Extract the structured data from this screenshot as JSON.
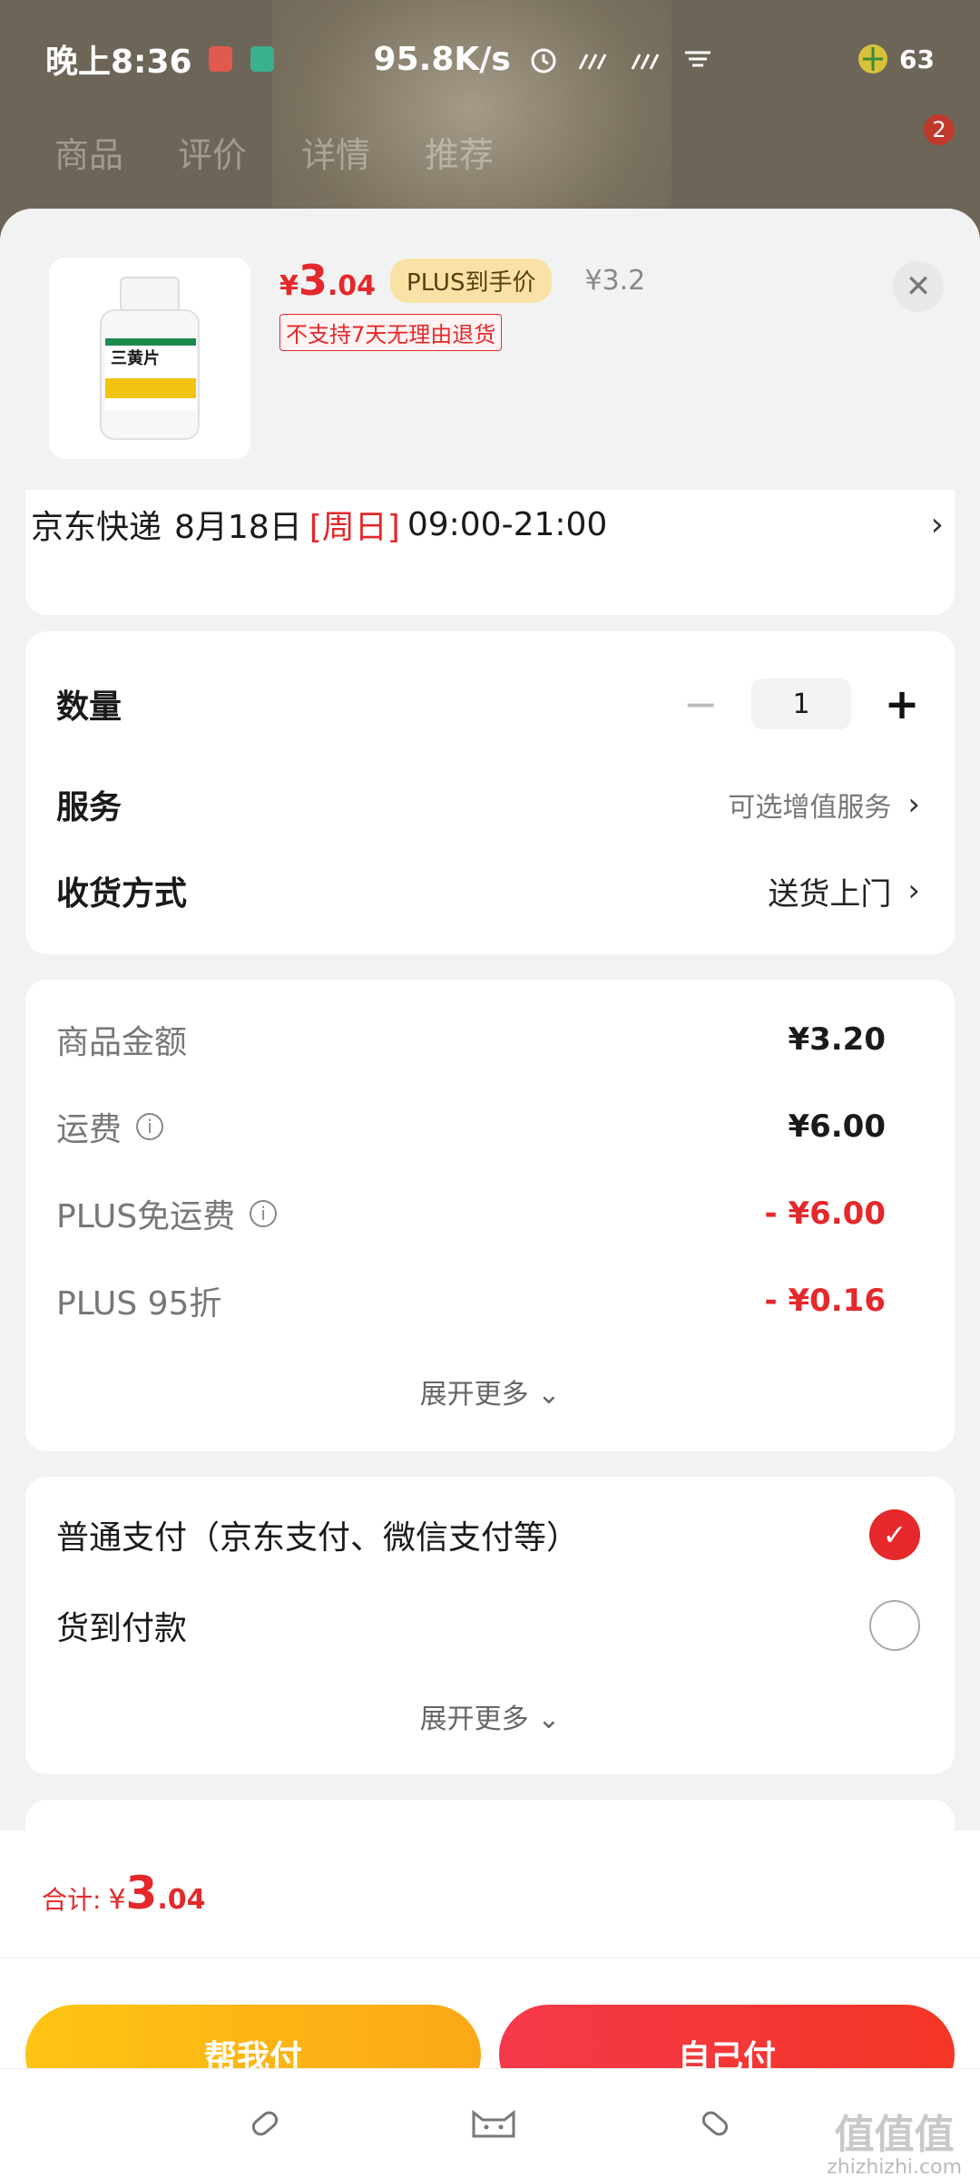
{
  "status_bar": {
    "time": "晚上8:36",
    "network_speed": "95.8K/s",
    "battery": "63"
  },
  "background": {
    "tabs": [
      "商品",
      "评价",
      "详情",
      "推荐"
    ],
    "cart_badge": "2"
  },
  "product": {
    "price_currency": "¥",
    "price_int": "3",
    "price_dec": ".04",
    "plus_tag": "PLUS到手价",
    "original_price": "¥3.2",
    "return_policy": "不支持7天无理由退货",
    "label_text": "三黄片",
    "close_label": "✕"
  },
  "delivery": {
    "carrier": "京东快递",
    "date": "8月18日",
    "weekday": "[周日]",
    "time_window": "09:00-21:00"
  },
  "quantity": {
    "label": "数量",
    "value": "1",
    "minus": "−",
    "plus": "+"
  },
  "service": {
    "label": "服务",
    "value": "可选增值服务"
  },
  "receive": {
    "label": "收货方式",
    "value": "送货上门"
  },
  "fees": {
    "items": [
      {
        "label": "商品金额",
        "value": "¥3.20",
        "info": false,
        "red": false
      },
      {
        "label": "运费",
        "value": "¥6.00",
        "info": true,
        "red": false
      },
      {
        "label": "PLUS免运费",
        "value": "- ¥6.00",
        "info": true,
        "red": true
      },
      {
        "label": "PLUS 95折",
        "value": "- ¥0.16",
        "info": false,
        "red": true
      }
    ],
    "expand_label": "展开更多"
  },
  "payment": {
    "options": [
      {
        "label": "普通支付（京东支付、微信支付等）",
        "selected": true
      },
      {
        "label": "货到付款",
        "selected": false
      }
    ],
    "expand_label": "展开更多"
  },
  "footer": {
    "total_label": "合计:",
    "total_currency": "¥",
    "total_int": "3",
    "total_dec": ".04",
    "help_pay": "帮我付",
    "self_pay": "自己付"
  },
  "watermark": {
    "big": "值值值",
    "small": "zhizhizhi.com"
  },
  "colors": {
    "accent_red": "#e4282b",
    "help_button": "#fdb515",
    "self_button": "#f33535",
    "plus_tag_bg": "#f8e2a6"
  }
}
